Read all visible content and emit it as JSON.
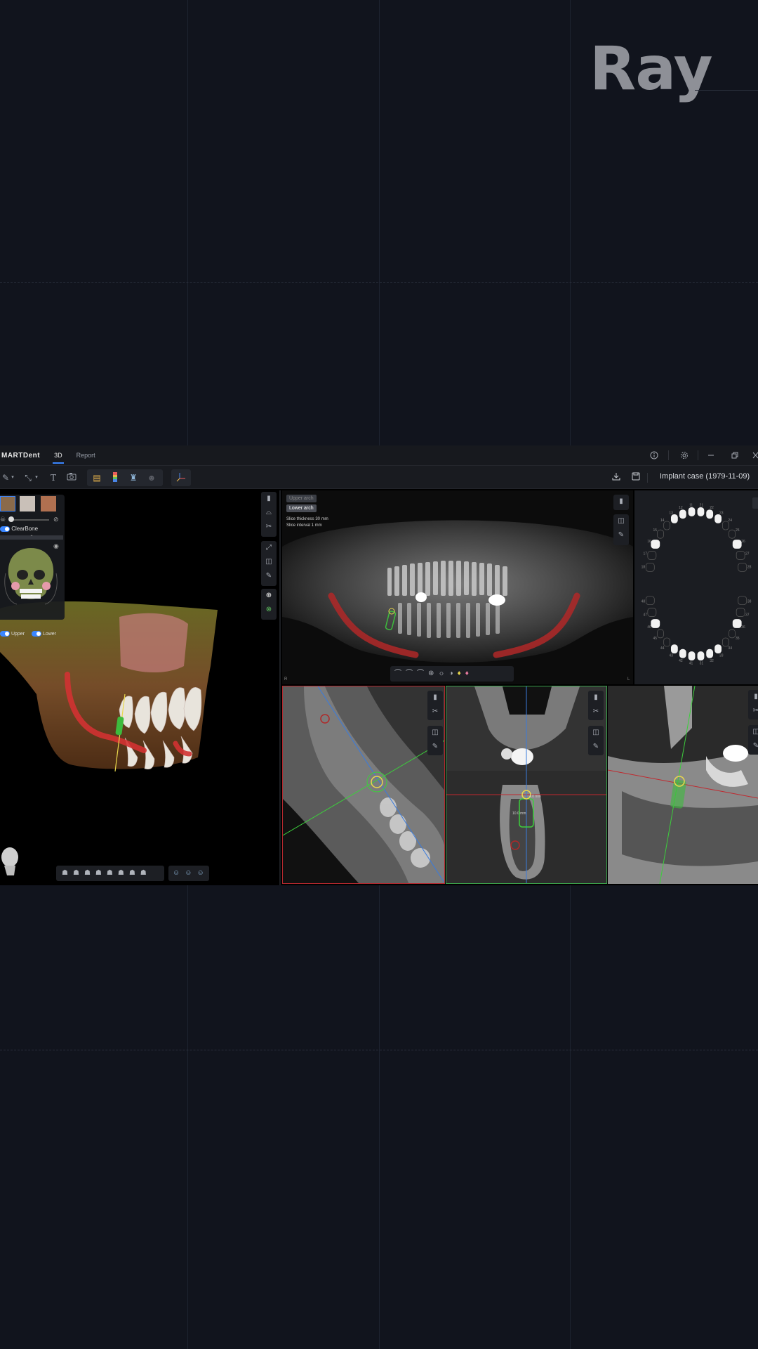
{
  "brand": {
    "wordmark": "Ray"
  },
  "app": {
    "logo": "MARTDent",
    "tabs": [
      {
        "label": "3D",
        "active": true
      },
      {
        "label": "Report",
        "active": false
      }
    ],
    "window_controls": [
      "info-icon",
      "gear-icon",
      "minimize-icon",
      "restore-icon",
      "close-icon"
    ],
    "case_title": "Implant case (1979-11-09)",
    "accent": "#3a86ff"
  },
  "left_panel": {
    "clearbone_label": "ClearBone",
    "upper_label": "Upper",
    "lower_label": "Lower",
    "clearbone_on": true,
    "upper_on": true,
    "lower_on": true
  },
  "pano": {
    "arch_upper": "Upper arch",
    "arch_lower": "Lower arch",
    "slice_thickness": "Slice thickness 30 mm",
    "slice_interval": "Slice interval 1 mm",
    "corner_left": "R",
    "corner_right": "L"
  },
  "tooth_chart": {
    "upper_numbers": [
      "18",
      "17",
      "16",
      "15",
      "14",
      "13",
      "12",
      "11",
      "21",
      "22",
      "23",
      "24",
      "25",
      "26",
      "27",
      "28"
    ],
    "lower_numbers": [
      "48",
      "47",
      "46",
      "45",
      "44",
      "43",
      "42",
      "41",
      "31",
      "32",
      "33",
      "34",
      "35",
      "36",
      "37",
      "38"
    ]
  },
  "axial": {
    "measure_1": "4.0 mm",
    "measure_2": "10.0 mm"
  }
}
